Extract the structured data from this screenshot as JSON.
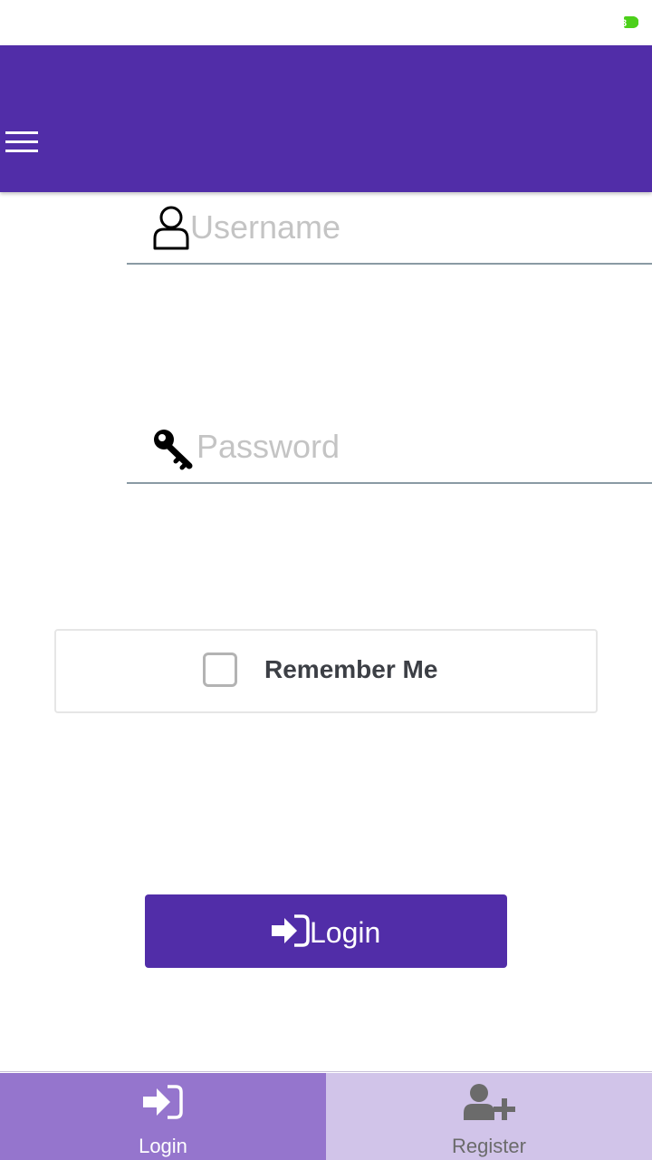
{
  "status_bar": {
    "battery_icon": "battery-charging-icon",
    "battery_color": "#4CD01A"
  },
  "app_bar": {
    "menu_icon": "hamburger-menu-icon",
    "background": "#512DA8"
  },
  "form": {
    "username": {
      "icon": "user-outline-icon",
      "placeholder": "Username",
      "value": ""
    },
    "password": {
      "icon": "key-icon",
      "placeholder": "Password",
      "value": ""
    },
    "remember_me": {
      "label": "Remember Me",
      "checked": false
    },
    "login_button": {
      "icon": "sign-in-icon",
      "label": "Login"
    }
  },
  "bottom_nav": {
    "items": [
      {
        "icon": "sign-in-icon",
        "label": "Login",
        "active": true,
        "background": "#9575CD"
      },
      {
        "icon": "user-plus-icon",
        "label": "Register",
        "active": false,
        "background": "#D1C4E9"
      }
    ]
  }
}
